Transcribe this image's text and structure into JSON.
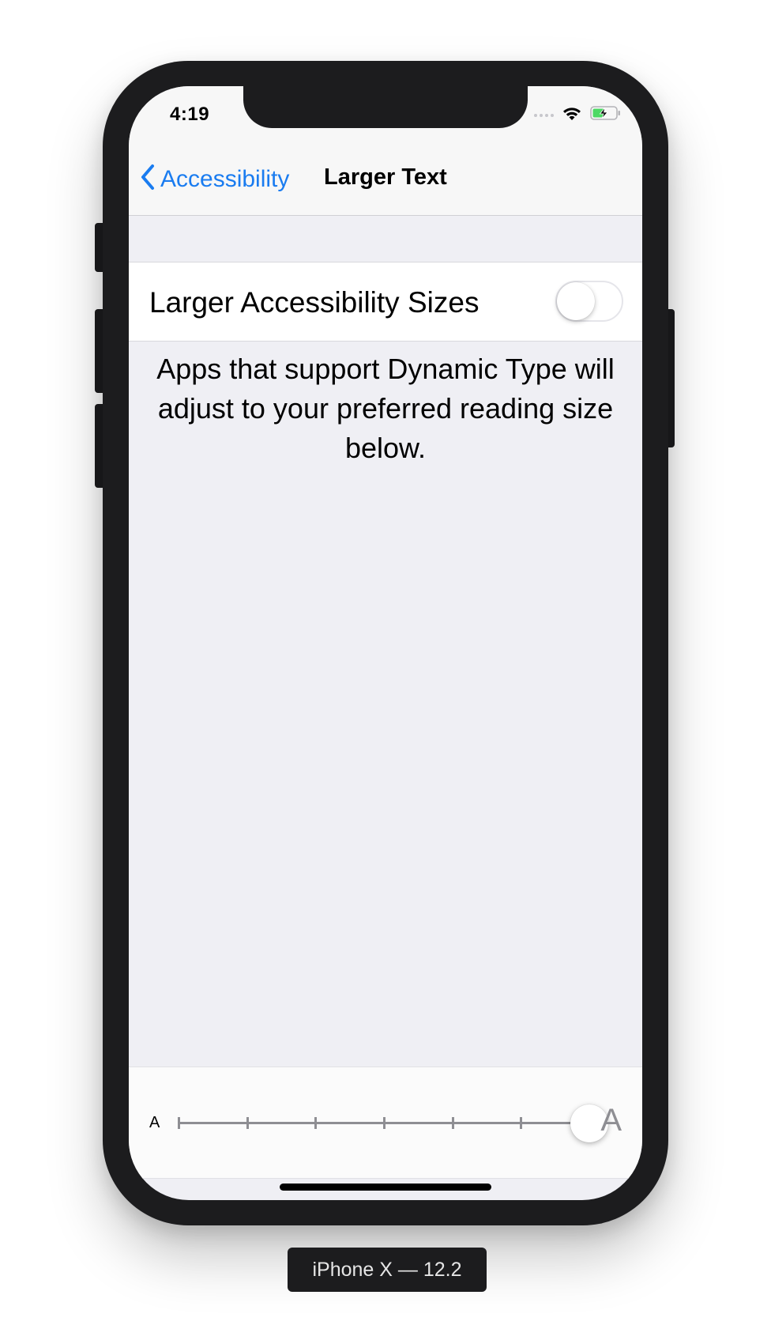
{
  "status_bar": {
    "time": "4:19",
    "icons": [
      "cellular-signal-icon",
      "wifi-icon",
      "battery-charging-icon"
    ]
  },
  "nav": {
    "back_label": "Accessibility",
    "title": "Larger Text"
  },
  "settings": {
    "toggle_label": "Larger Accessibility Sizes",
    "toggle_on": false,
    "description": "Apps that support Dynamic Type will adjust to your preferred reading size below."
  },
  "slider": {
    "small_label": "A",
    "large_label": "A",
    "steps": 7,
    "selected_step": 7
  },
  "device": {
    "label": "iPhone X — 12.2"
  },
  "colors": {
    "accent": "#1a7cf0",
    "background": "#efeff4",
    "frame": "#1c1c1e"
  }
}
